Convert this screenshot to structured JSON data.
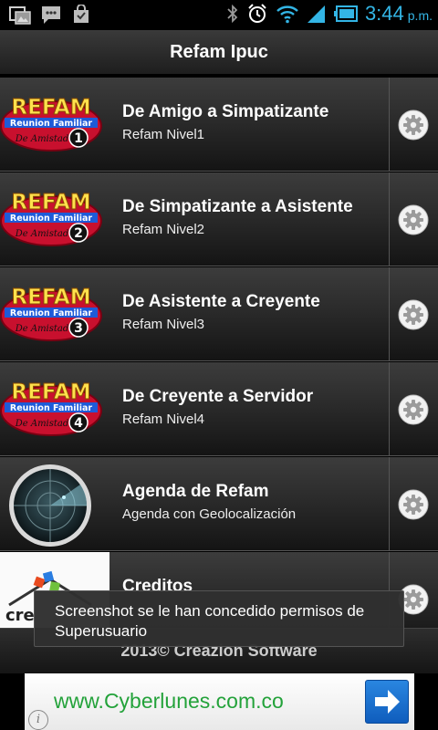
{
  "status_bar": {
    "left_icons": [
      "gallery-icon",
      "messages-icon",
      "store-icon"
    ],
    "right_icons": [
      "bluetooth-icon",
      "alarm-icon",
      "wifi-icon",
      "signal-icon",
      "battery-icon"
    ],
    "time": "3:44",
    "ampm": "p.m.",
    "accent_color": "#33b5e5"
  },
  "header": {
    "title": "Refam Ipuc"
  },
  "list": {
    "items": [
      {
        "title": "De Amigo a Simpatizante",
        "subtitle": "Refam Nivel1",
        "thumb": "refam-logo",
        "level": "1",
        "logo_text": "REFAM",
        "logo_sub": "Reunion Familiar",
        "logo_tag": "De Amistad"
      },
      {
        "title": "De Simpatizante a Asistente",
        "subtitle": "Refam Nivel2",
        "thumb": "refam-logo",
        "level": "2",
        "logo_text": "REFAM",
        "logo_sub": "Reunion Familiar",
        "logo_tag": "De Amistad"
      },
      {
        "title": "De Asistente a Creyente",
        "subtitle": "Refam Nivel3",
        "thumb": "refam-logo",
        "level": "3",
        "logo_text": "REFAM",
        "logo_sub": "Reunion Familiar",
        "logo_tag": "De Amistad"
      },
      {
        "title": "De Creyente a Servidor",
        "subtitle": "Refam Nivel4",
        "thumb": "refam-logo",
        "level": "4",
        "logo_text": "REFAM",
        "logo_sub": "Reunion Familiar",
        "logo_tag": "De Amistad"
      },
      {
        "title": "Agenda de Refam",
        "subtitle": "Agenda con Geolocalización",
        "thumb": "radar-icon"
      },
      {
        "title": "Creditos",
        "subtitle": "",
        "thumb": "creazion-logo"
      }
    ],
    "action_icon": "gear-icon"
  },
  "footer": {
    "text": "2013© Creazion Software"
  },
  "toast": {
    "text": "Screenshot se le han concedido permisos de Superusuario"
  },
  "ad": {
    "url": "www.Cyberlunes.com.co",
    "button_icon": "arrow-right-icon",
    "info_icon": "info-icon",
    "info_label": "i"
  }
}
